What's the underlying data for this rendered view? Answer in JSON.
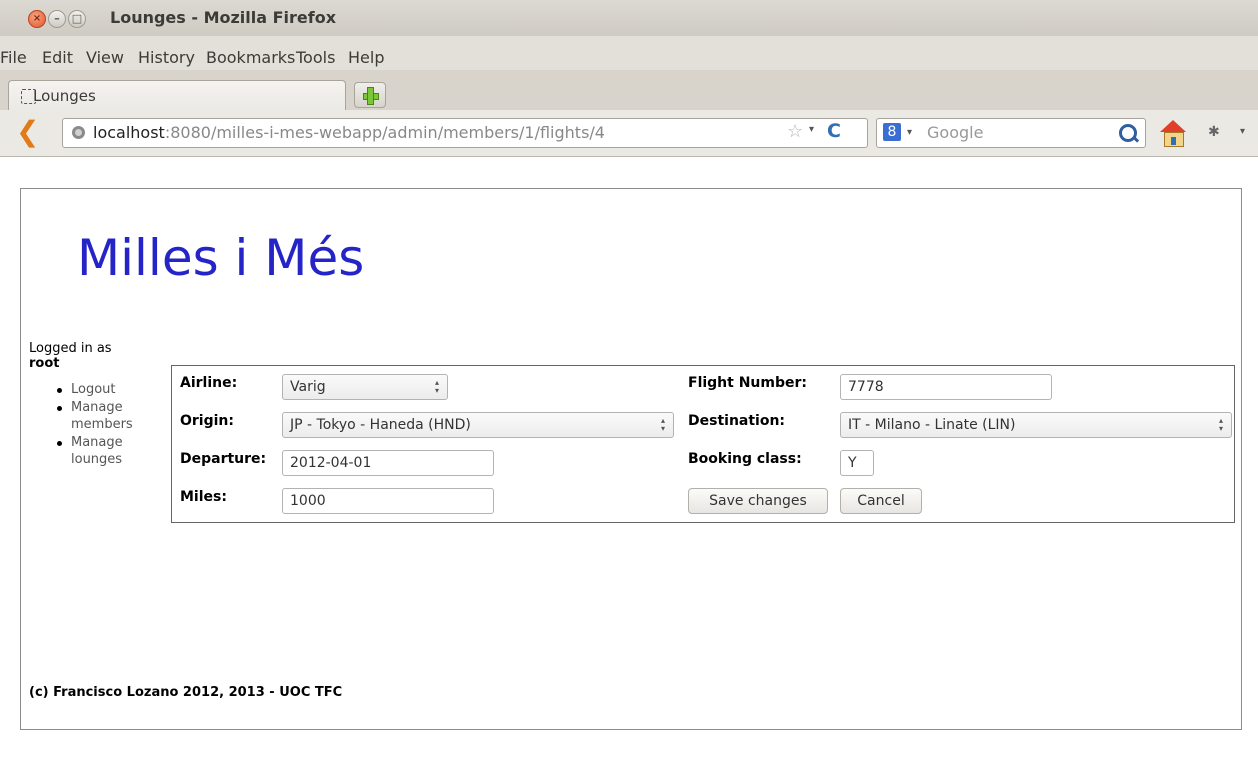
{
  "window": {
    "title": "Lounges - Mozilla Firefox",
    "close_glyph": "×",
    "min_glyph": "–",
    "max_glyph": "□"
  },
  "menubar": {
    "items": [
      "File",
      "Edit",
      "View",
      "History",
      "Bookmarks",
      "Tools",
      "Help"
    ]
  },
  "tabs": {
    "active_label": "Lounges"
  },
  "navbar": {
    "back_glyph": "❮",
    "url_host": "localhost",
    "url_rest": ":8080/milles-i-mes-webapp/admin/members/1/flights/4",
    "star_glyph": "☆",
    "drop_glyph": "▾",
    "reload_glyph": "C",
    "search_engine_glyph": "8",
    "search_placeholder": "Google",
    "addon_glyph": "✱"
  },
  "page": {
    "site_title": "Milles i Més",
    "logged_in_label": "Logged in as",
    "username": "root",
    "menu": [
      "Logout",
      "Manage members",
      "Manage lounges"
    ],
    "footer": "(c) Francisco Lozano 2012, 2013 - UOC TFC"
  },
  "form": {
    "airline_label": "Airline:",
    "airline_value": "Varig",
    "flight_number_label": "Flight Number:",
    "flight_number_value": "7778",
    "origin_label": "Origin:",
    "origin_value": "JP - Tokyo - Haneda (HND)",
    "destination_label": "Destination:",
    "destination_value": "IT - Milano - Linate (LIN)",
    "departure_label": "Departure:",
    "departure_value": "2012-04-01",
    "booking_class_label": "Booking class:",
    "booking_class_value": "Y",
    "miles_label": "Miles:",
    "miles_value": "1000",
    "save_label": "Save changes",
    "cancel_label": "Cancel",
    "spin_up": "▴",
    "spin_down": "▾"
  }
}
